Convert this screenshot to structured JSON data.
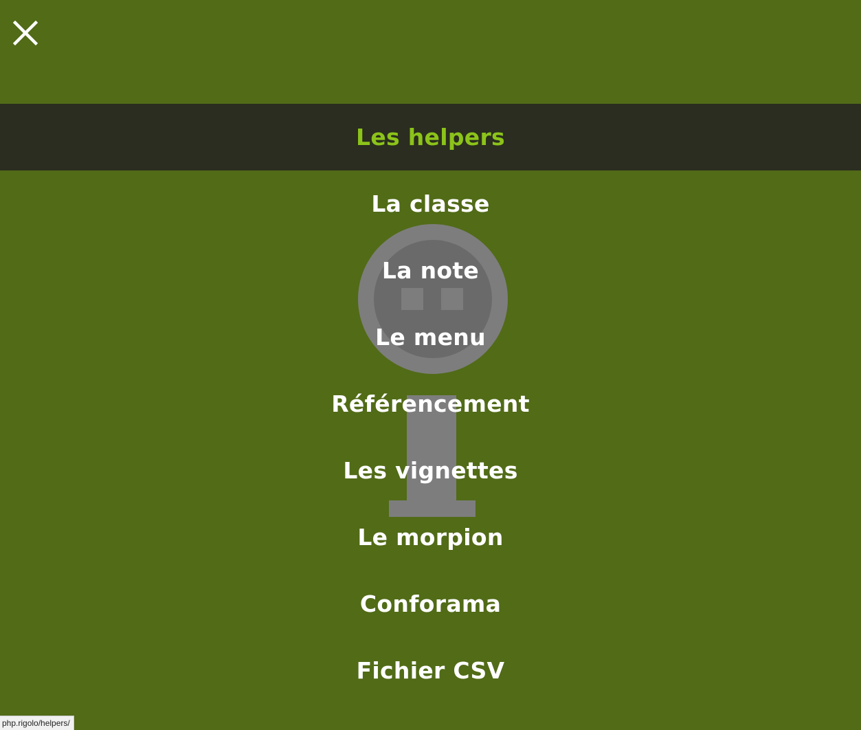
{
  "overlay": {
    "close_icon": "close-icon",
    "background_color": "#516b17",
    "active_background_color": "#2a2d1f",
    "active_text_color": "#8cc31a",
    "mascot_color": "#808080"
  },
  "menu": {
    "items": [
      {
        "label": "Les helpers",
        "active": true
      },
      {
        "label": "La classe",
        "active": false
      },
      {
        "label": "La note",
        "active": false
      },
      {
        "label": "Le menu",
        "active": false
      },
      {
        "label": "Référencement",
        "active": false
      },
      {
        "label": "Les vignettes",
        "active": false
      },
      {
        "label": "Le morpion",
        "active": false
      },
      {
        "label": "Conforama",
        "active": false
      },
      {
        "label": "Fichier CSV",
        "active": false
      }
    ]
  },
  "status_bar": {
    "url": "php.rigolo/helpers/"
  }
}
